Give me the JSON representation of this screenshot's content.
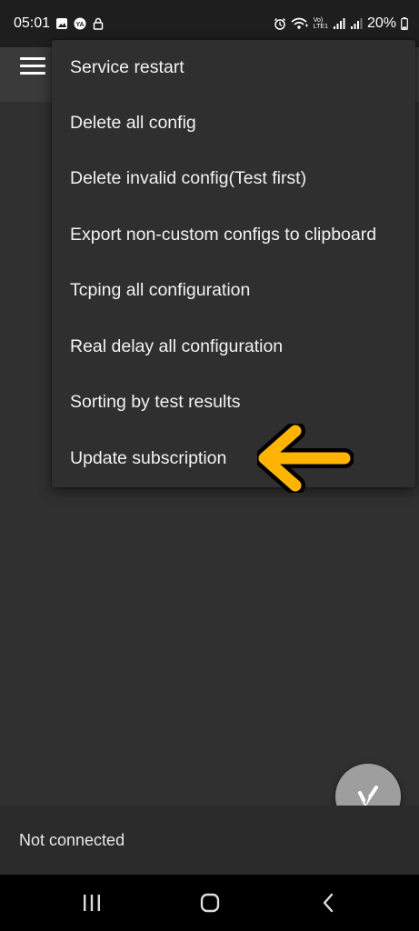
{
  "status_bar": {
    "time": "05:01",
    "battery_percent": "20%",
    "network_label": "LTE1",
    "icons": [
      "gallery-icon",
      "app-notification-icon",
      "lock-icon",
      "alarm-icon",
      "wifi-icon",
      "volte-icon",
      "signal-icon",
      "signal-icon-2",
      "battery-icon"
    ]
  },
  "toolbar": {
    "menu_icon": "hamburger-icon"
  },
  "overflow_menu": {
    "items": [
      {
        "label": "Service restart"
      },
      {
        "label": "Delete all config"
      },
      {
        "label": "Delete invalid config(Test first)"
      },
      {
        "label": "Export non-custom configs to clipboard"
      },
      {
        "label": "Tcping all configuration"
      },
      {
        "label": "Real delay all configuration"
      },
      {
        "label": "Sorting by test results"
      },
      {
        "label": "Update subscription"
      }
    ]
  },
  "annotation": {
    "arrow_icon": "pointing-arrow-icon",
    "color": "#ffb400"
  },
  "fab": {
    "icon": "v-logo-icon",
    "color": "#9e9e9e"
  },
  "connection_status": {
    "text": "Not connected"
  },
  "nav_bar": {
    "icons": [
      "recent-apps-icon",
      "home-icon",
      "back-icon"
    ]
  }
}
